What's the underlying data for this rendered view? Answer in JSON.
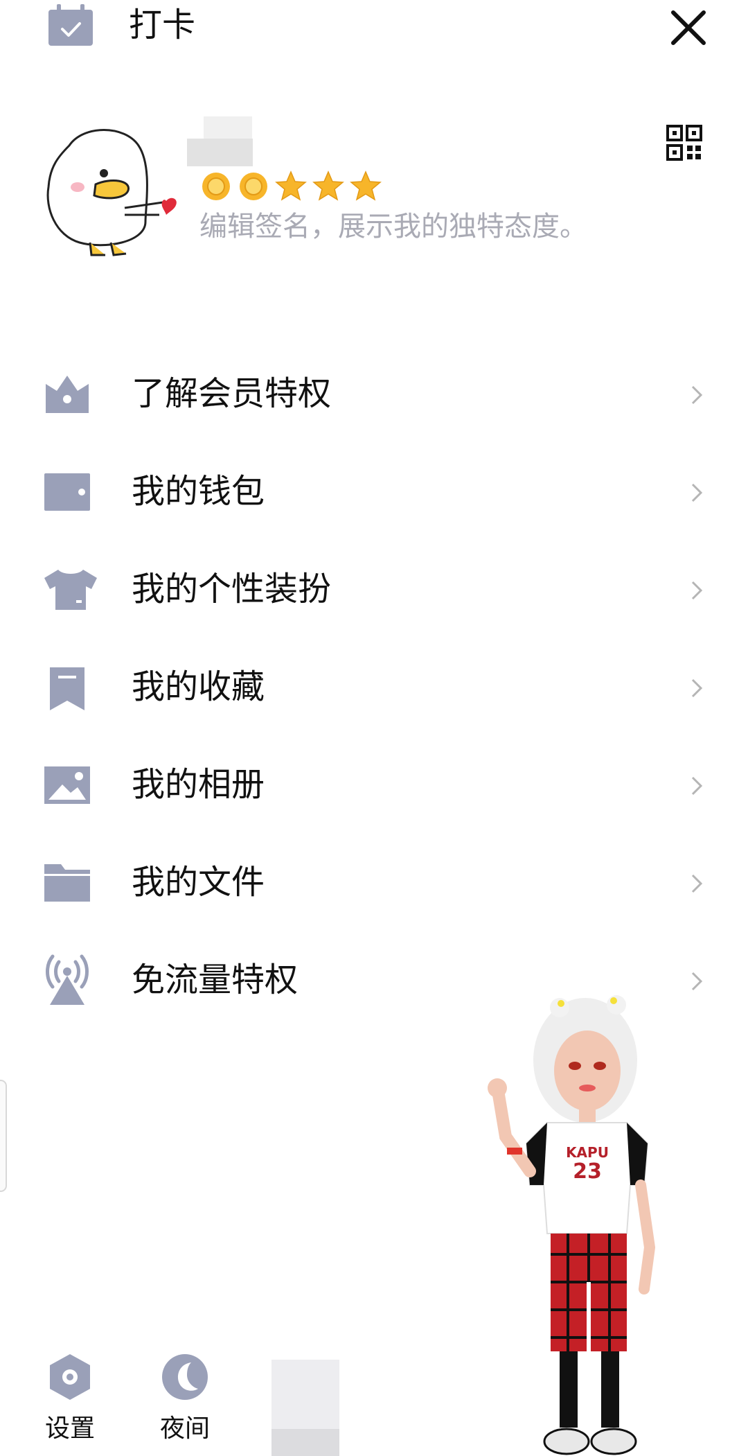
{
  "header": {
    "checkin_label": "打卡",
    "icon_checkin": "calendar-check-icon",
    "icon_close": "close-icon"
  },
  "profile": {
    "stars_count": 5,
    "stars_level_icons": 2,
    "signature": "编辑签名，展示我的独特态度。",
    "icon_qr": "qr-code-icon"
  },
  "menu": {
    "items": [
      {
        "label": "了解会员特权",
        "icon": "crown-icon"
      },
      {
        "label": "我的钱包",
        "icon": "wallet-icon"
      },
      {
        "label": "我的个性装扮",
        "icon": "shirt-icon"
      },
      {
        "label": "我的收藏",
        "icon": "bookmark-icon"
      },
      {
        "label": "我的相册",
        "icon": "image-icon"
      },
      {
        "label": "我的文件",
        "icon": "folder-icon"
      },
      {
        "label": "免流量特权",
        "icon": "signal-tower-icon"
      }
    ]
  },
  "bottom": {
    "settings_label": "设置",
    "night_label": "夜间",
    "icon_settings": "settings-icon",
    "icon_night": "moon-icon"
  },
  "colors": {
    "icon_gray": "#9aa0b8",
    "signature_gray": "#a9aab4",
    "star_gold": "#f7b52a"
  }
}
